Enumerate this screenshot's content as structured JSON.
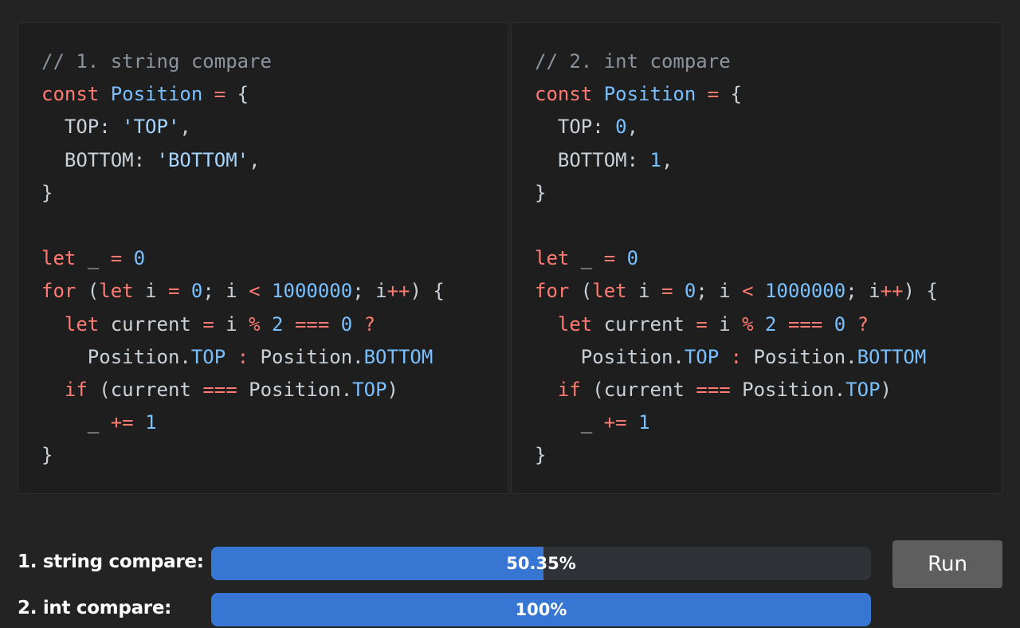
{
  "panels": [
    {
      "name": "string-compare",
      "lines": [
        [
          {
            "t": "// 1. string compare",
            "c": "c"
          }
        ],
        [
          {
            "t": "const",
            "c": "k"
          },
          {
            "t": " "
          },
          {
            "t": "Position",
            "c": "n"
          },
          {
            "t": " "
          },
          {
            "t": "=",
            "c": "k"
          },
          {
            "t": " {"
          }
        ],
        [
          {
            "t": "  TOP: "
          },
          {
            "t": "'TOP'",
            "c": "s"
          },
          {
            "t": ","
          }
        ],
        [
          {
            "t": "  BOTTOM: "
          },
          {
            "t": "'BOTTOM'",
            "c": "s"
          },
          {
            "t": ","
          }
        ],
        [
          {
            "t": "}"
          }
        ],
        [
          {
            "t": ""
          }
        ],
        [
          {
            "t": "let",
            "c": "k"
          },
          {
            "t": " _ "
          },
          {
            "t": "=",
            "c": "k"
          },
          {
            "t": " "
          },
          {
            "t": "0",
            "c": "n"
          }
        ],
        [
          {
            "t": "for",
            "c": "k"
          },
          {
            "t": " ("
          },
          {
            "t": "let",
            "c": "k"
          },
          {
            "t": " i "
          },
          {
            "t": "=",
            "c": "k"
          },
          {
            "t": " "
          },
          {
            "t": "0",
            "c": "n"
          },
          {
            "t": "; i "
          },
          {
            "t": "<",
            "c": "k"
          },
          {
            "t": " "
          },
          {
            "t": "1000000",
            "c": "n"
          },
          {
            "t": "; i"
          },
          {
            "t": "++",
            "c": "k"
          },
          {
            "t": ") {"
          }
        ],
        [
          {
            "t": "  "
          },
          {
            "t": "let",
            "c": "k"
          },
          {
            "t": " current "
          },
          {
            "t": "=",
            "c": "k"
          },
          {
            "t": " i "
          },
          {
            "t": "%",
            "c": "k"
          },
          {
            "t": " "
          },
          {
            "t": "2",
            "c": "n"
          },
          {
            "t": " "
          },
          {
            "t": "===",
            "c": "k"
          },
          {
            "t": " "
          },
          {
            "t": "0",
            "c": "n"
          },
          {
            "t": " "
          },
          {
            "t": "?",
            "c": "k"
          }
        ],
        [
          {
            "t": "    Position."
          },
          {
            "t": "TOP",
            "c": "n"
          },
          {
            "t": " "
          },
          {
            "t": ":",
            "c": "k"
          },
          {
            "t": " Position."
          },
          {
            "t": "BOTTOM",
            "c": "n"
          }
        ],
        [
          {
            "t": "  "
          },
          {
            "t": "if",
            "c": "k"
          },
          {
            "t": " (current "
          },
          {
            "t": "===",
            "c": "k"
          },
          {
            "t": " Position."
          },
          {
            "t": "TOP",
            "c": "n"
          },
          {
            "t": ")"
          }
        ],
        [
          {
            "t": "    _ "
          },
          {
            "t": "+=",
            "c": "k"
          },
          {
            "t": " "
          },
          {
            "t": "1",
            "c": "n"
          }
        ],
        [
          {
            "t": "}"
          }
        ]
      ]
    },
    {
      "name": "int-compare",
      "lines": [
        [
          {
            "t": "// 2. int compare",
            "c": "c"
          }
        ],
        [
          {
            "t": "const",
            "c": "k"
          },
          {
            "t": " "
          },
          {
            "t": "Position",
            "c": "n"
          },
          {
            "t": " "
          },
          {
            "t": "=",
            "c": "k"
          },
          {
            "t": " {"
          }
        ],
        [
          {
            "t": "  TOP: "
          },
          {
            "t": "0",
            "c": "n"
          },
          {
            "t": ","
          }
        ],
        [
          {
            "t": "  BOTTOM: "
          },
          {
            "t": "1",
            "c": "n"
          },
          {
            "t": ","
          }
        ],
        [
          {
            "t": "}"
          }
        ],
        [
          {
            "t": ""
          }
        ],
        [
          {
            "t": "let",
            "c": "k"
          },
          {
            "t": " _ "
          },
          {
            "t": "=",
            "c": "k"
          },
          {
            "t": " "
          },
          {
            "t": "0",
            "c": "n"
          }
        ],
        [
          {
            "t": "for",
            "c": "k"
          },
          {
            "t": " ("
          },
          {
            "t": "let",
            "c": "k"
          },
          {
            "t": " i "
          },
          {
            "t": "=",
            "c": "k"
          },
          {
            "t": " "
          },
          {
            "t": "0",
            "c": "n"
          },
          {
            "t": "; i "
          },
          {
            "t": "<",
            "c": "k"
          },
          {
            "t": " "
          },
          {
            "t": "1000000",
            "c": "n"
          },
          {
            "t": "; i"
          },
          {
            "t": "++",
            "c": "k"
          },
          {
            "t": ") {"
          }
        ],
        [
          {
            "t": "  "
          },
          {
            "t": "let",
            "c": "k"
          },
          {
            "t": " current "
          },
          {
            "t": "=",
            "c": "k"
          },
          {
            "t": " i "
          },
          {
            "t": "%",
            "c": "k"
          },
          {
            "t": " "
          },
          {
            "t": "2",
            "c": "n"
          },
          {
            "t": " "
          },
          {
            "t": "===",
            "c": "k"
          },
          {
            "t": " "
          },
          {
            "t": "0",
            "c": "n"
          },
          {
            "t": " "
          },
          {
            "t": "?",
            "c": "k"
          }
        ],
        [
          {
            "t": "    Position."
          },
          {
            "t": "TOP",
            "c": "n"
          },
          {
            "t": " "
          },
          {
            "t": ":",
            "c": "k"
          },
          {
            "t": " Position."
          },
          {
            "t": "BOTTOM",
            "c": "n"
          }
        ],
        [
          {
            "t": "  "
          },
          {
            "t": "if",
            "c": "k"
          },
          {
            "t": " (current "
          },
          {
            "t": "===",
            "c": "k"
          },
          {
            "t": " Position."
          },
          {
            "t": "TOP",
            "c": "n"
          },
          {
            "t": ")"
          }
        ],
        [
          {
            "t": "    _ "
          },
          {
            "t": "+=",
            "c": "k"
          },
          {
            "t": " "
          },
          {
            "t": "1",
            "c": "n"
          }
        ],
        [
          {
            "t": "}"
          }
        ]
      ]
    }
  ],
  "results": [
    {
      "label": "1. string compare:",
      "percent_text": "50.35%",
      "fill_percent": 50.35
    },
    {
      "label": "2. int compare:",
      "percent_text": "100%",
      "fill_percent": 100
    }
  ],
  "run_button": {
    "label": "Run"
  },
  "colors": {
    "background": "#232323",
    "panel": "#1e1e1e",
    "comment": "#8b949e",
    "keyword": "#ff7b72",
    "number_or_identifier": "#79c0ff",
    "string": "#a5d6ff",
    "bar_fill": "#3776d3",
    "bar_track": "#2f3236",
    "button": "#5e5e5e"
  }
}
